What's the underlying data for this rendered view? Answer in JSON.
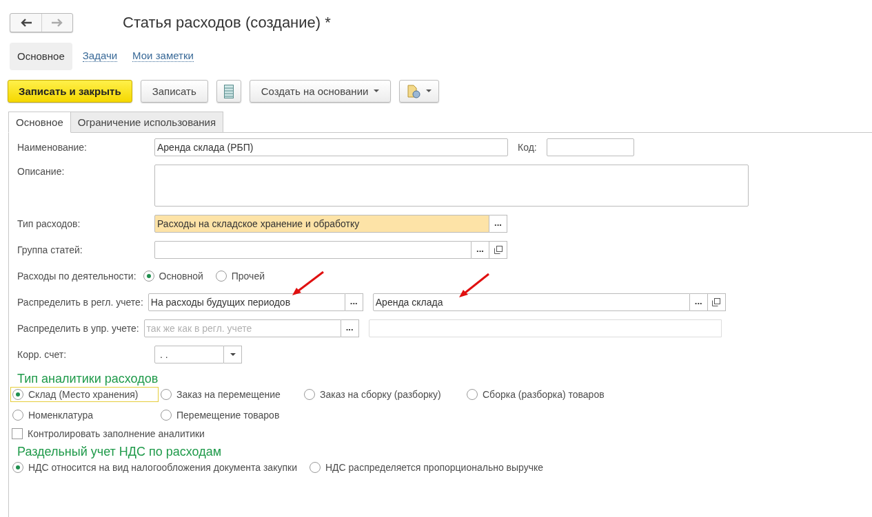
{
  "nav": {
    "back": {
      "disabled": false
    },
    "forward": {
      "disabled": true
    }
  },
  "title": "Статья расходов (создание) *",
  "sections": [
    {
      "label": "Основное",
      "selected": true
    },
    {
      "label": "Задачи",
      "selected": false
    },
    {
      "label": "Мои заметки",
      "selected": false
    }
  ],
  "toolbar": [
    {
      "kind": "primary",
      "label": "Записать и закрыть"
    },
    {
      "kind": "default",
      "label": "Записать"
    },
    {
      "kind": "list_icon"
    },
    {
      "kind": "dropdown",
      "label": "Создать на основании"
    },
    {
      "kind": "report_dropdown"
    }
  ],
  "tabs": [
    {
      "label": "Основное",
      "selected": true
    },
    {
      "label": "Ограничение использования",
      "selected": false
    }
  ],
  "rows": [
    {
      "kind": "name_code",
      "label": "Наименование:",
      "value": "Аренда склада (РБП)",
      "code_label": "Код:"
    },
    {
      "kind": "textarea",
      "label": "Описание:"
    },
    {
      "kind": "select",
      "label": "Тип расходов:",
      "value": "Расходы на складское хранение и обработку",
      "highlighted": true,
      "choose_button": "..."
    },
    {
      "kind": "select",
      "label": "Группа статей:",
      "highlighted": false,
      "choose_button": "...",
      "open_button": true
    },
    {
      "kind": "radio",
      "label": "Расходы по деятельности:",
      "options": [
        {
          "label": "Основной",
          "selected": true
        },
        {
          "label": "Прочей",
          "selected": false
        }
      ]
    },
    {
      "kind": "select_pair",
      "label": "Распределить в регл. учете:",
      "first": {
        "value": "На расходы будущих периодов",
        "choose_button": "..."
      },
      "second": {
        "value": "Аренда склада",
        "choose_button": "...",
        "open_button": true,
        "disabled": false
      }
    },
    {
      "kind": "select_pair",
      "label": "Распределить в упр. учете:",
      "first": {
        "placeholder": "так же как в регл. учете",
        "choose_button": "..."
      },
      "second": {
        "disabled": true
      }
    },
    {
      "kind": "combo",
      "label": "Корр. счет:",
      "value": ". ."
    }
  ],
  "groups": [
    {
      "title": "Тип аналитики расходов",
      "options": [
        {
          "label": "Склад (Место хранения)",
          "selected": true,
          "focused": true
        },
        {
          "label": "Заказ на перемещение",
          "selected": false,
          "focused": false
        },
        {
          "label": "Заказ на сборку (разборку)",
          "selected": false,
          "focused": false
        },
        {
          "label": "Сборка (разборка) товаров",
          "selected": false,
          "focused": false
        },
        {
          "label": "Номенклатура",
          "selected": false,
          "focused": false
        },
        {
          "label": "Перемещение товаров",
          "selected": false,
          "focused": false
        }
      ],
      "checkbox": {
        "label": "Контролировать заполнение аналитики",
        "checked": false
      }
    },
    {
      "title": "Раздельный учет НДС по расходам",
      "options": [
        {
          "label": "НДС относится на вид налогообложения документа закупки",
          "selected": true,
          "focused": false
        },
        {
          "label": "НДС распределяется пропорционально выручке",
          "selected": false,
          "focused": false
        }
      ]
    }
  ]
}
